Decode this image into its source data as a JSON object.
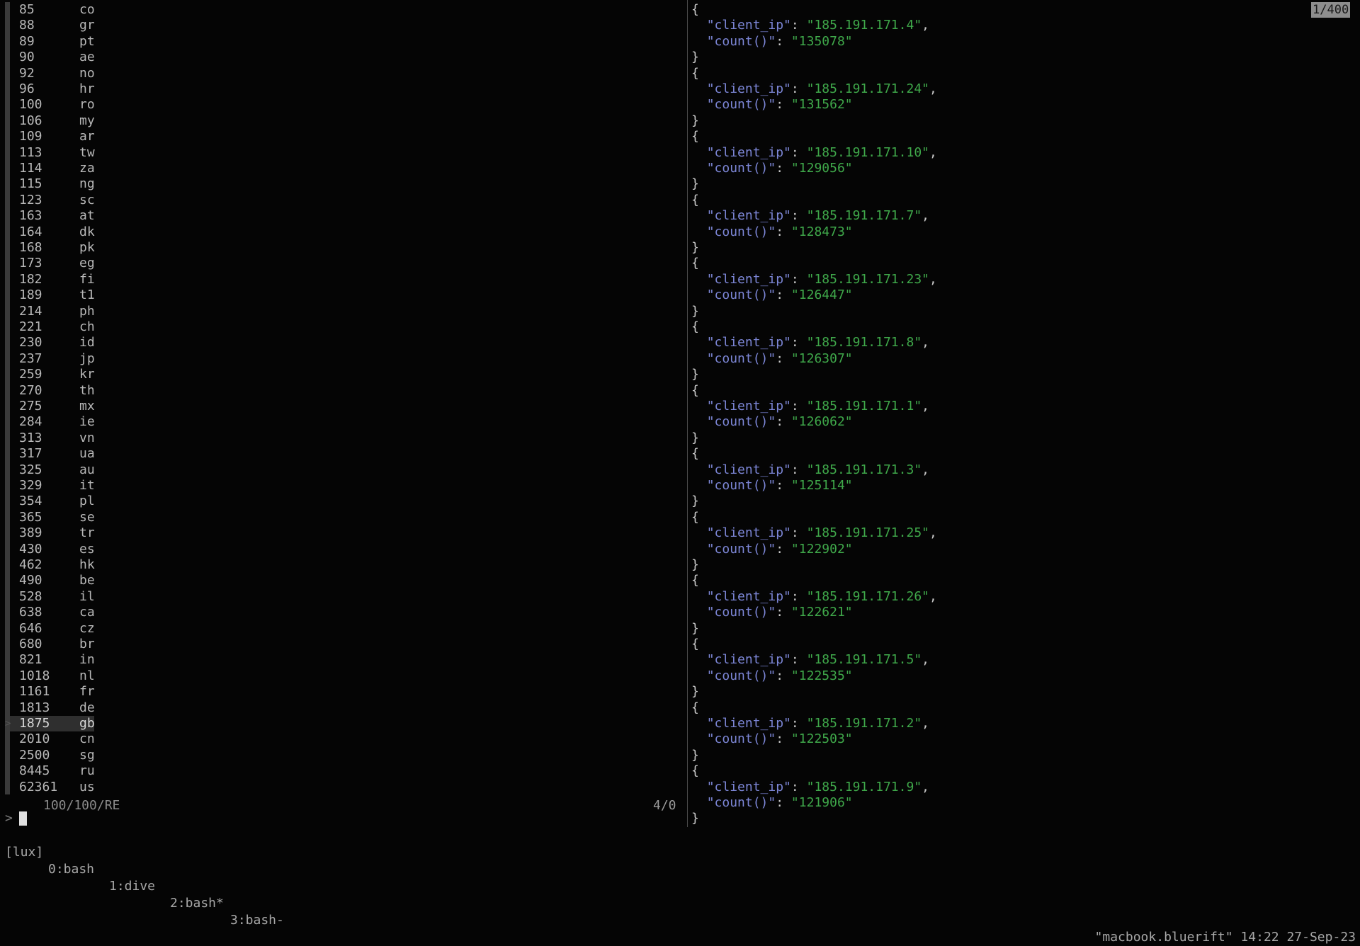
{
  "fzf": {
    "rows": [
      {
        "count": "85",
        "code": "co"
      },
      {
        "count": "88",
        "code": "gr"
      },
      {
        "count": "89",
        "code": "pt"
      },
      {
        "count": "90",
        "code": "ae"
      },
      {
        "count": "92",
        "code": "no"
      },
      {
        "count": "96",
        "code": "hr"
      },
      {
        "count": "100",
        "code": "ro"
      },
      {
        "count": "106",
        "code": "my"
      },
      {
        "count": "109",
        "code": "ar"
      },
      {
        "count": "113",
        "code": "tw"
      },
      {
        "count": "114",
        "code": "za"
      },
      {
        "count": "115",
        "code": "ng"
      },
      {
        "count": "123",
        "code": "sc"
      },
      {
        "count": "163",
        "code": "at"
      },
      {
        "count": "164",
        "code": "dk"
      },
      {
        "count": "168",
        "code": "pk"
      },
      {
        "count": "173",
        "code": "eg"
      },
      {
        "count": "182",
        "code": "fi"
      },
      {
        "count": "189",
        "code": "t1"
      },
      {
        "count": "214",
        "code": "ph"
      },
      {
        "count": "221",
        "code": "ch"
      },
      {
        "count": "230",
        "code": "id"
      },
      {
        "count": "237",
        "code": "jp"
      },
      {
        "count": "259",
        "code": "kr"
      },
      {
        "count": "270",
        "code": "th"
      },
      {
        "count": "275",
        "code": "mx"
      },
      {
        "count": "284",
        "code": "ie"
      },
      {
        "count": "313",
        "code": "vn"
      },
      {
        "count": "317",
        "code": "ua"
      },
      {
        "count": "325",
        "code": "au"
      },
      {
        "count": "329",
        "code": "it"
      },
      {
        "count": "354",
        "code": "pl"
      },
      {
        "count": "365",
        "code": "se"
      },
      {
        "count": "389",
        "code": "tr"
      },
      {
        "count": "430",
        "code": "es"
      },
      {
        "count": "462",
        "code": "hk"
      },
      {
        "count": "490",
        "code": "be"
      },
      {
        "count": "528",
        "code": "il"
      },
      {
        "count": "638",
        "code": "ca"
      },
      {
        "count": "646",
        "code": "cz"
      },
      {
        "count": "680",
        "code": "br"
      },
      {
        "count": "821",
        "code": "in"
      },
      {
        "count": "1018",
        "code": "nl"
      },
      {
        "count": "1161",
        "code": "fr"
      },
      {
        "count": "1813",
        "code": "de"
      },
      {
        "count": "1875",
        "code": "gb",
        "selected": true
      },
      {
        "count": "2010",
        "code": "cn"
      },
      {
        "count": "2500",
        "code": "sg"
      },
      {
        "count": "8445",
        "code": "ru"
      },
      {
        "count": "62361",
        "code": "us"
      }
    ],
    "selected_marker": ">",
    "info": "100/100/RE",
    "preview_position": "4/0",
    "prompt": ">"
  },
  "preview": {
    "scroll_indicator": "1/400",
    "key_ip": "\"client_ip\"",
    "key_count": "\"count()\"",
    "records": [
      {
        "client_ip": "185.191.171.4",
        "count": "135078"
      },
      {
        "client_ip": "185.191.171.24",
        "count": "131562"
      },
      {
        "client_ip": "185.191.171.10",
        "count": "129056"
      },
      {
        "client_ip": "185.191.171.7",
        "count": "128473"
      },
      {
        "client_ip": "185.191.171.23",
        "count": "126447"
      },
      {
        "client_ip": "185.191.171.8",
        "count": "126307"
      },
      {
        "client_ip": "185.191.171.1",
        "count": "126062"
      },
      {
        "client_ip": "185.191.171.3",
        "count": "125114"
      },
      {
        "client_ip": "185.191.171.25",
        "count": "122902"
      },
      {
        "client_ip": "185.191.171.26",
        "count": "122621"
      },
      {
        "client_ip": "185.191.171.5",
        "count": "122535"
      },
      {
        "client_ip": "185.191.171.2",
        "count": "122503"
      },
      {
        "client_ip": "185.191.171.9",
        "count": "121906"
      }
    ]
  },
  "tmux": {
    "session": "[lux]",
    "windows": [
      {
        "label": "0:bash"
      },
      {
        "label": "1:dive"
      },
      {
        "label": "2:bash*"
      },
      {
        "label": "3:bash-"
      }
    ],
    "status_right": "\"macbook.bluerift\" 14:22 27-Sep-23"
  },
  "colors": {
    "background": "#050505",
    "json_key": "#7c86d6",
    "json_string": "#3fa84a",
    "text": "#b8b8b8"
  }
}
